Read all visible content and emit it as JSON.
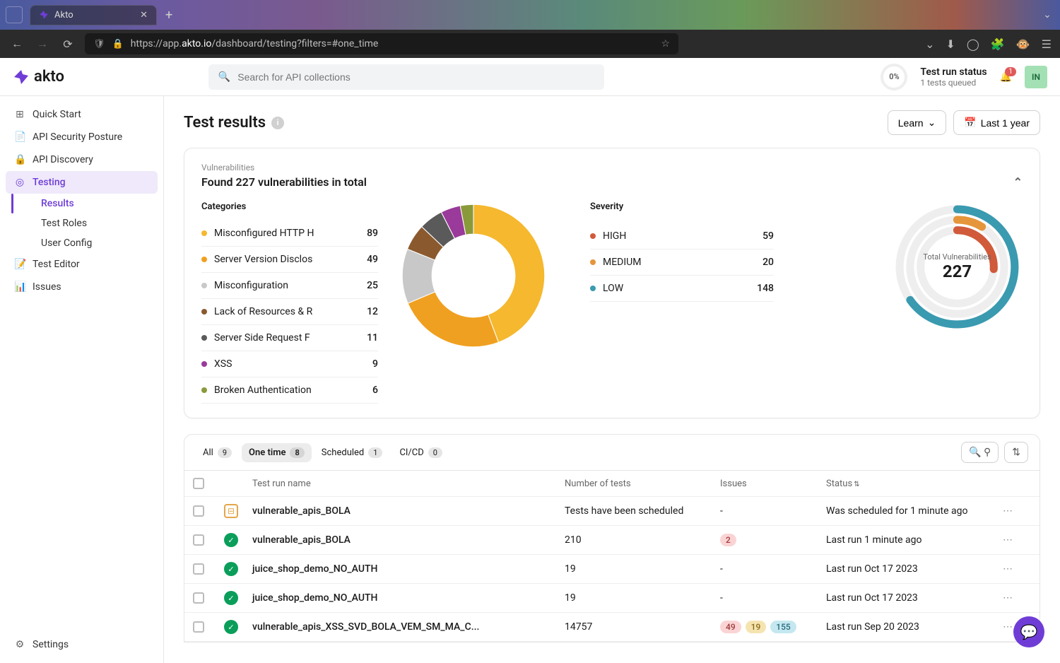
{
  "browser": {
    "tab_title": "Akto",
    "url_prefix": "https://app.",
    "url_bold": "akto.io",
    "url_suffix": "/dashboard/testing?filters=#one_time"
  },
  "header": {
    "logo_text": "akto",
    "search_placeholder": "Search for API collections",
    "progress": "0%",
    "status_title": "Test run status",
    "status_sub": "1 tests queued",
    "bell_badge": "1",
    "avatar_initials": "IN"
  },
  "sidebar": {
    "items": [
      {
        "label": "Quick Start",
        "icon": "⊞"
      },
      {
        "label": "API Security Posture",
        "icon": "📄"
      },
      {
        "label": "API Discovery",
        "icon": "🔒"
      },
      {
        "label": "Testing",
        "icon": "◎",
        "active": true
      },
      {
        "label": "Test Editor",
        "icon": "📝"
      },
      {
        "label": "Issues",
        "icon": "📊"
      }
    ],
    "testing_children": [
      {
        "label": "Results",
        "active": true
      },
      {
        "label": "Test Roles"
      },
      {
        "label": "User Config"
      }
    ],
    "settings": "Settings"
  },
  "page": {
    "title": "Test results",
    "learn_btn": "Learn",
    "date_btn": "Last 1 year"
  },
  "vuln_card": {
    "subtitle": "Vulnerabilities",
    "title": "Found 227 vulnerabilities in total",
    "categories_label": "Categories",
    "severity_label": "Severity",
    "ring_label": "Total Vulnerabilities",
    "ring_value": "227"
  },
  "chart_data": {
    "categories_donut": {
      "type": "pie",
      "title": "Categories",
      "series": [
        {
          "name": "Misconfigured HTTP H",
          "value": 89,
          "color": "#f5b82e"
        },
        {
          "name": "Server Version Disclos",
          "value": 49,
          "color": "#f0a020"
        },
        {
          "name": "Misconfiguration",
          "value": 25,
          "color": "#c8c8c8"
        },
        {
          "name": "Lack of Resources & R",
          "value": 12,
          "color": "#8a5a2e"
        },
        {
          "name": "Server Side Request F",
          "value": 11,
          "color": "#5a5a5a"
        },
        {
          "name": "XSS",
          "value": 9,
          "color": "#9a3a9a"
        },
        {
          "name": "Broken Authentication",
          "value": 6,
          "color": "#8a9a3a"
        }
      ]
    },
    "severity_rings": {
      "type": "radial",
      "title": "Total Vulnerabilities",
      "total": 227,
      "series": [
        {
          "name": "HIGH",
          "value": 59,
          "color": "#d05a3a"
        },
        {
          "name": "MEDIUM",
          "value": 20,
          "color": "#e5953a"
        },
        {
          "name": "LOW",
          "value": 148,
          "color": "#3a9ab0"
        }
      ]
    }
  },
  "tabs": [
    {
      "label": "All",
      "count": "9"
    },
    {
      "label": "One time",
      "count": "8",
      "active": true
    },
    {
      "label": "Scheduled",
      "count": "1"
    },
    {
      "label": "CI/CD",
      "count": "0"
    }
  ],
  "table": {
    "columns": {
      "name": "Test run name",
      "tests": "Number of tests",
      "issues": "Issues",
      "status": "Status"
    },
    "rows": [
      {
        "status": "scheduled",
        "name": "vulnerable_apis_BOLA",
        "tests": "Tests have been scheduled",
        "issues": [],
        "issues_dash": "-",
        "status_text": "Was scheduled for 1 minute ago"
      },
      {
        "status": "done",
        "name": "vulnerable_apis_BOLA",
        "tests": "210",
        "issues": [
          {
            "v": "2",
            "c": "high"
          }
        ],
        "status_text": "Last run 1 minute ago"
      },
      {
        "status": "done",
        "name": "juice_shop_demo_NO_AUTH",
        "tests": "19",
        "issues": [],
        "issues_dash": "-",
        "status_text": "Last run Oct 17 2023"
      },
      {
        "status": "done",
        "name": "juice_shop_demo_NO_AUTH",
        "tests": "19",
        "issues": [],
        "issues_dash": "-",
        "status_text": "Last run Oct 17 2023"
      },
      {
        "status": "done",
        "name": "vulnerable_apis_XSS_SVD_BOLA_VEM_SM_MA_C...",
        "tests": "14757",
        "issues": [
          {
            "v": "49",
            "c": "high"
          },
          {
            "v": "19",
            "c": "med"
          },
          {
            "v": "155",
            "c": "low"
          }
        ],
        "status_text": "Last run Sep 20 2023"
      }
    ]
  }
}
